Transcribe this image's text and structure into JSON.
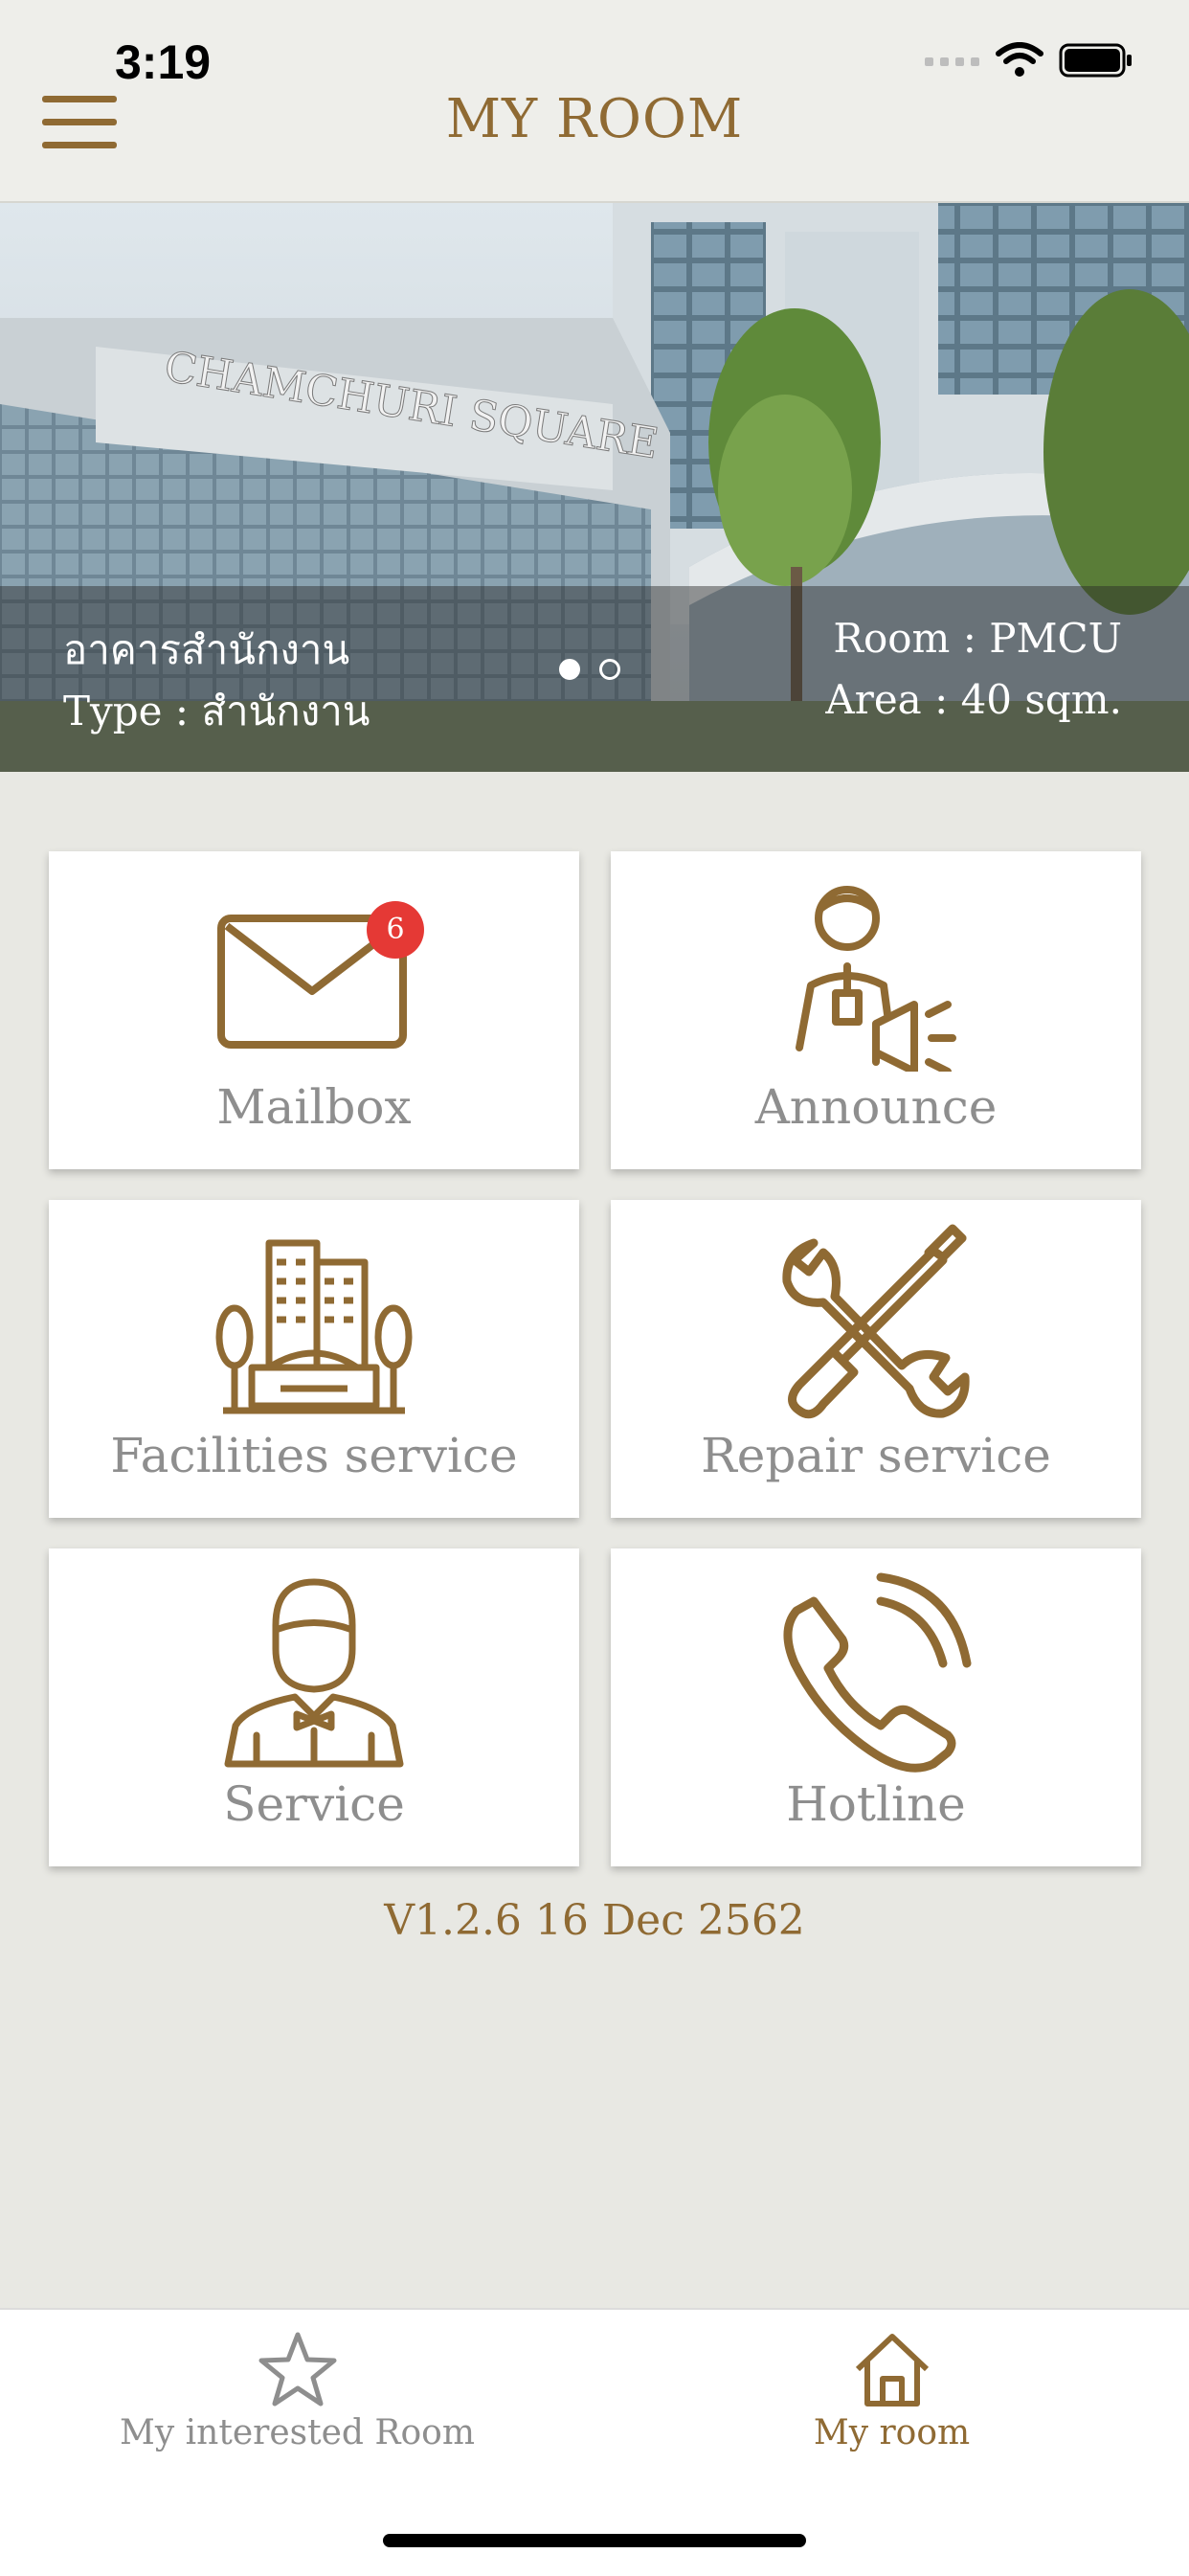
{
  "status_bar": {
    "time": "3:19"
  },
  "header": {
    "title": "MY ROOM"
  },
  "banner": {
    "building_name": "อาคารสำนักงาน",
    "type": "Type : สำนักงาน",
    "room": "Room : PMCU",
    "area": "Area : 40 sqm.",
    "sign_text": "CHAMCHURI SQUARE",
    "slides": 2,
    "active_slide": 1
  },
  "tiles": {
    "mailbox": {
      "label": "Mailbox",
      "badge": "6",
      "icon": "envelope-icon"
    },
    "announce": {
      "label": "Announce",
      "icon": "announcer-megaphone-icon"
    },
    "facilities": {
      "label": "Facilities service",
      "icon": "buildings-icon"
    },
    "repair": {
      "label": "Repair service",
      "icon": "wrench-screwdriver-icon"
    },
    "service": {
      "label": "Service",
      "icon": "butler-icon"
    },
    "hotline": {
      "label": "Hotline",
      "icon": "phone-icon"
    }
  },
  "version": "V1.2.6 16 Dec 2562",
  "tabbar": {
    "interested": {
      "label": "My interested Room",
      "icon": "star-icon"
    },
    "myroom": {
      "label": "My room",
      "icon": "home-icon"
    }
  },
  "colors": {
    "accent": "#8f6a33",
    "badge": "#e53935",
    "label_gray": "#8e8e8e",
    "background": "#e8e8e3"
  }
}
